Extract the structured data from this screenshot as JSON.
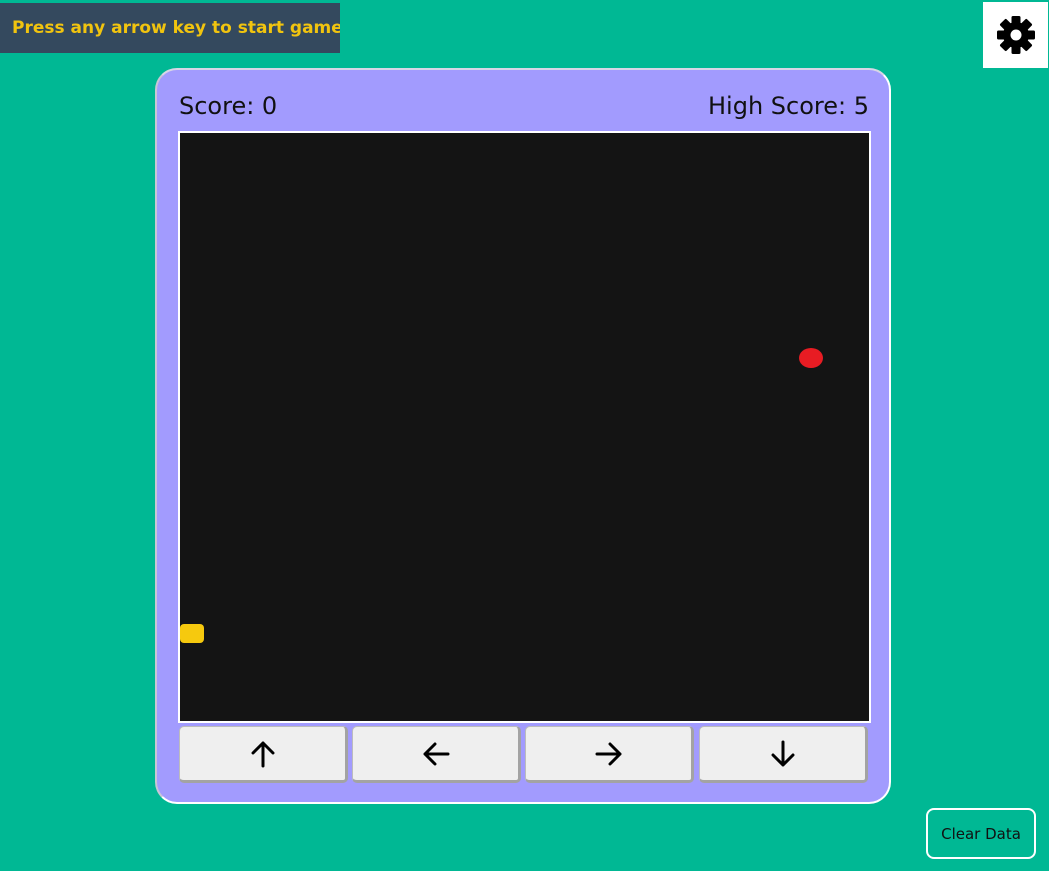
{
  "banner": {
    "message": "Press any arrow key to start game !"
  },
  "settings": {
    "icon": "gear-icon"
  },
  "game": {
    "score_text": "Score: 0",
    "high_score_text": "High Score: 5",
    "snake_color": "#f6c90e",
    "food_color": "#e81c23",
    "board_color": "#141414"
  },
  "controls": [
    {
      "icon": "arrow-up-icon"
    },
    {
      "icon": "arrow-left-icon"
    },
    {
      "icon": "arrow-right-icon"
    },
    {
      "icon": "arrow-down-icon"
    }
  ],
  "footer": {
    "clear_label": "Clear Data"
  },
  "colors": {
    "background": "#00b894",
    "panel": "#a29bfe",
    "banner_bg": "#34495e",
    "banner_text": "#f1c40f"
  }
}
